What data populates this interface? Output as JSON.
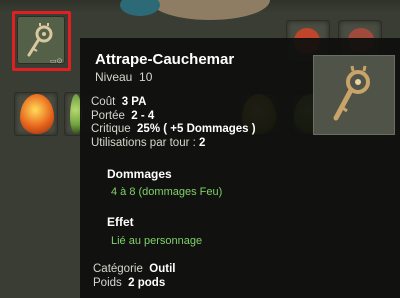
{
  "inventory": {
    "selected_item_icon": "key-staff-icon",
    "selected_badge": "▭⊙",
    "egg_colors": [
      "#e8641c",
      "#6fa23d",
      "#8a9f2a",
      "#c8a62c",
      "#9aa23a"
    ]
  },
  "tooltip": {
    "item_name": "Attrape-Cauchemar",
    "level_label": "Niveau",
    "level_value": "10",
    "cost_label": "Coût",
    "cost_value": "3 PA",
    "range_label": "Portée",
    "range_value": "2 - 4",
    "critical_label": "Critique",
    "critical_value": "25% ( +5 Dommages )",
    "uses_label": "Utilisations par tour :",
    "uses_value": "2",
    "damage_heading": "Dommages",
    "damage_value": "4 à 8 (dommages Feu)",
    "effect_heading": "Effet",
    "effect_value": "Lié au personnage",
    "category_label": "Catégorie",
    "category_value": "Outil",
    "weight_label": "Poids",
    "weight_value": "2 pods",
    "accent_green": "#7fd06a"
  }
}
